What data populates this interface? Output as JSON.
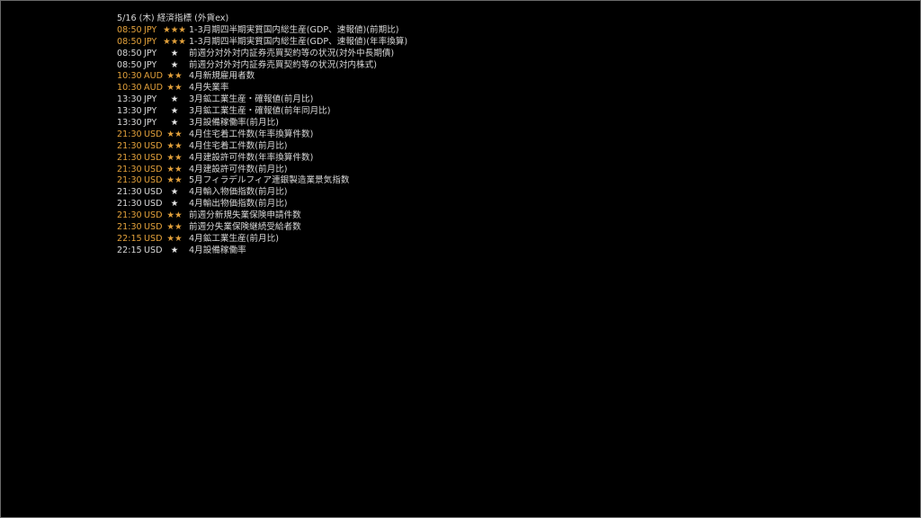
{
  "header": {
    "title": "5/16 (木) 経済指標 (外貨ex)"
  },
  "colors": {
    "background": "#000000",
    "highlight": "#e3a13b",
    "normal_text": "#d8d8d8",
    "border": "#6a6a6a"
  },
  "events": [
    {
      "time": "08:50",
      "currency": "JPY",
      "stars": "★★★",
      "importance": "high",
      "name": "1-3月期四半期実質国内総生産(GDP、速報値)(前期比)"
    },
    {
      "time": "08:50",
      "currency": "JPY",
      "stars": "★★★",
      "importance": "high",
      "name": "1-3月期四半期実質国内総生産(GDP、速報値)(年率換算)"
    },
    {
      "time": "08:50",
      "currency": "JPY",
      "stars": "★",
      "importance": "low",
      "name": "前週分対外対内証券売買契約等の状況(対外中長期債)"
    },
    {
      "time": "08:50",
      "currency": "JPY",
      "stars": "★",
      "importance": "low",
      "name": "前週分対外対内証券売買契約等の状況(対内株式)"
    },
    {
      "time": "10:30",
      "currency": "AUD",
      "stars": "★★",
      "importance": "mid",
      "name": "4月新規雇用者数"
    },
    {
      "time": "10:30",
      "currency": "AUD",
      "stars": "★★",
      "importance": "mid",
      "name": "4月失業率"
    },
    {
      "time": "13:30",
      "currency": "JPY",
      "stars": "★",
      "importance": "low",
      "name": "3月鉱工業生産・確報値(前月比)"
    },
    {
      "time": "13:30",
      "currency": "JPY",
      "stars": "★",
      "importance": "low",
      "name": "3月鉱工業生産・確報値(前年同月比)"
    },
    {
      "time": "13:30",
      "currency": "JPY",
      "stars": "★",
      "importance": "low",
      "name": "3月設備稼働率(前月比)"
    },
    {
      "time": "21:30",
      "currency": "USD",
      "stars": "★★",
      "importance": "mid",
      "name": "4月住宅着工件数(年率換算件数)"
    },
    {
      "time": "21:30",
      "currency": "USD",
      "stars": "★★",
      "importance": "mid",
      "name": "4月住宅着工件数(前月比)"
    },
    {
      "time": "21:30",
      "currency": "USD",
      "stars": "★★",
      "importance": "mid",
      "name": "4月建設許可件数(年率換算件数)"
    },
    {
      "time": "21:30",
      "currency": "USD",
      "stars": "★★",
      "importance": "mid",
      "name": "4月建設許可件数(前月比)"
    },
    {
      "time": "21:30",
      "currency": "USD",
      "stars": "★★",
      "importance": "mid",
      "name": "5月フィラデルフィア連銀製造業景気指数"
    },
    {
      "time": "21:30",
      "currency": "USD",
      "stars": "★",
      "importance": "low",
      "name": "4月輸入物価指数(前月比)"
    },
    {
      "time": "21:30",
      "currency": "USD",
      "stars": "★",
      "importance": "low",
      "name": "4月輸出物価指数(前月比)"
    },
    {
      "time": "21:30",
      "currency": "USD",
      "stars": "★★",
      "importance": "mid",
      "name": "前週分新規失業保険申請件数"
    },
    {
      "time": "21:30",
      "currency": "USD",
      "stars": "★★",
      "importance": "mid",
      "name": "前週分失業保険継続受給者数"
    },
    {
      "time": "22:15",
      "currency": "USD",
      "stars": "★★",
      "importance": "mid",
      "name": "4月鉱工業生産(前月比)"
    },
    {
      "time": "22:15",
      "currency": "USD",
      "stars": "★",
      "importance": "low",
      "name": "4月設備稼働率"
    }
  ]
}
